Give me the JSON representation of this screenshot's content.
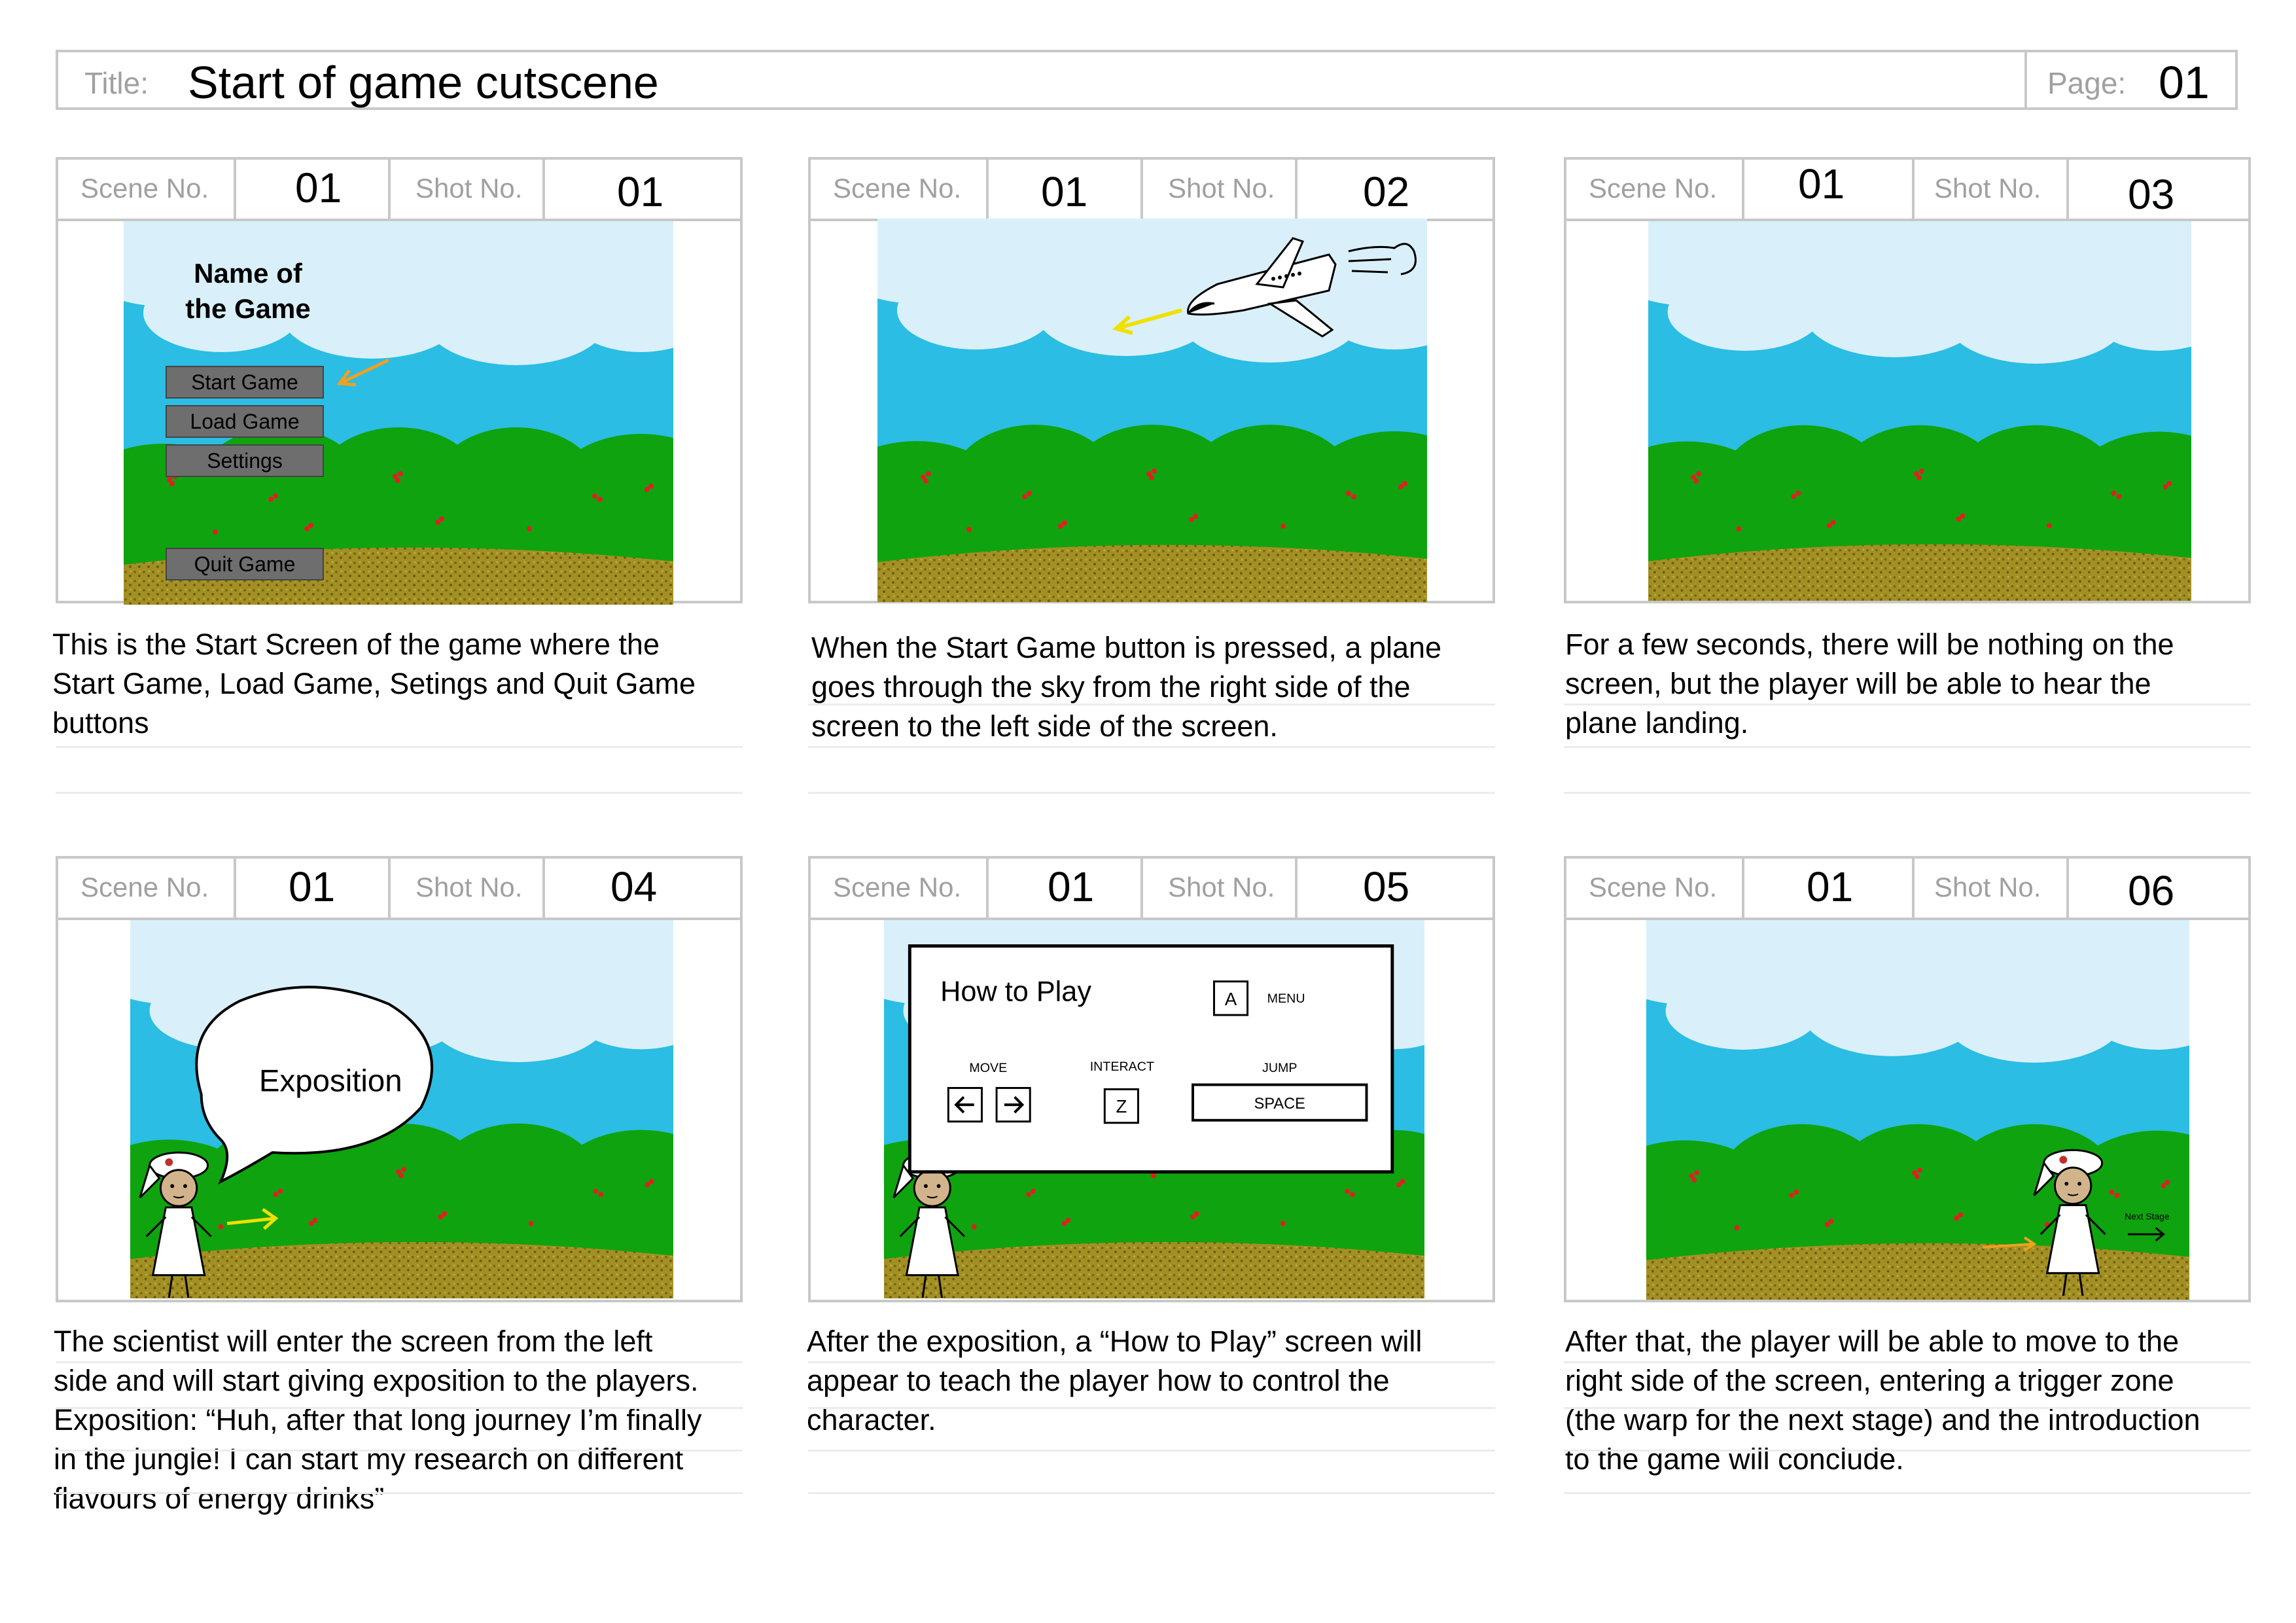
{
  "header": {
    "title_label": "Title:",
    "title": "Start of game cutscene",
    "page_label": "Page:",
    "page": "01"
  },
  "labels": {
    "scene": "Scene No.",
    "shot": "Shot No."
  },
  "panels": [
    {
      "scene": "01",
      "shot": "01",
      "caption": [
        "This is the Start Screen of the game where the",
        "Start Game, Load Game, Setings and Quit Game",
        "buttons"
      ],
      "menu": {
        "title_line1": "Name of",
        "title_line2": "the Game",
        "buttons": [
          "Start Game",
          "Load Game",
          "Settings",
          "Quit Game"
        ]
      }
    },
    {
      "scene": "01",
      "shot": "02",
      "caption": [
        "When the Start Game button is pressed, a plane",
        "goes through the sky from the right side of the",
        "screen to the left side of the screen."
      ]
    },
    {
      "scene": "01",
      "shot": "03",
      "caption": [
        "For a few seconds, there will be nothing on the",
        "screen, but the player will be able to hear the",
        "plane landing."
      ]
    },
    {
      "scene": "01",
      "shot": "04",
      "caption": [
        "The scientist will enter the screen from the left",
        "side and will start giving exposition to the players.",
        "Exposition: “Huh, after that long journey I’m finally",
        "in the jungle! I can start my research on different",
        "flavours of energy drinks”"
      ],
      "bubble": "Exposition"
    },
    {
      "scene": "01",
      "shot": "05",
      "caption": [
        "After the exposition, a “How to Play” screen will",
        "appear to teach the player how to control the",
        "character."
      ],
      "howto": {
        "title": "How to Play",
        "menu_key": "A",
        "menu_label": "MENU",
        "move_label": "MOVE",
        "interact_label": "INTERACT",
        "interact_key": "Z",
        "jump_label": "JUMP",
        "jump_key": "SPACE"
      }
    },
    {
      "scene": "01",
      "shot": "06",
      "caption": [
        "After that, the player will be able to move to the",
        "right side of the screen, entering a trigger zone",
        "(the warp for the next stage) and the introduction",
        "to the game will conclude."
      ],
      "next_stage": "Next Stage"
    }
  ],
  "colors": {
    "sky": "#2bbde3",
    "cloud": "#d6eef8",
    "bush": "#0fa30f",
    "ground": "#9b8a1f",
    "berry": "#e02020",
    "arrow_orange": "#f0a020",
    "arrow_yellow": "#f0e000",
    "border": "#c8c8c8"
  }
}
